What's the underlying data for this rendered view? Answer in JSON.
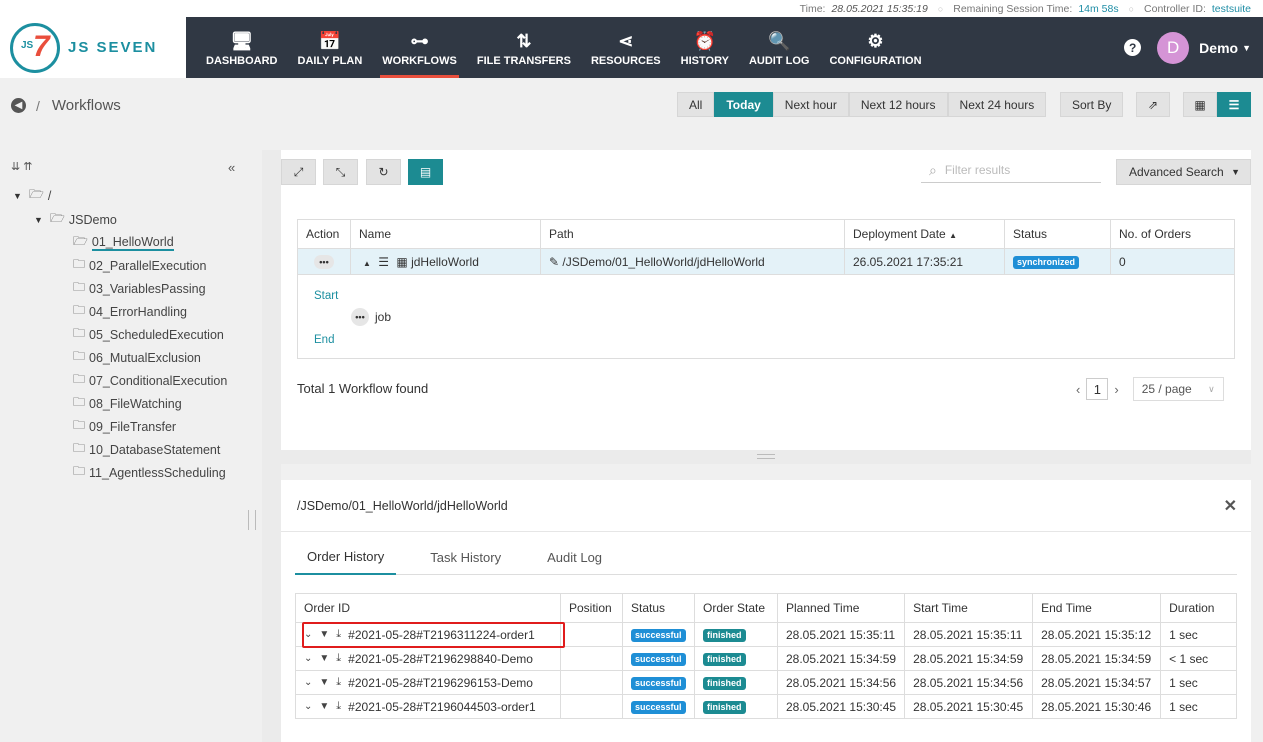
{
  "status_bar": {
    "time_label": "Time:",
    "time_value": "28.05.2021 15:35:19",
    "session_label": "Remaining Session Time:",
    "session_value": "14m 58s",
    "controller_label": "Controller ID:",
    "controller_value": "testsuite"
  },
  "logo": {
    "mark_small": "JS",
    "mark_big": "7",
    "text": "JS SEVEN"
  },
  "nav": [
    {
      "label": "DASHBOARD",
      "icon": "monitor-icon",
      "glyph": "🖥"
    },
    {
      "label": "DAILY PLAN",
      "icon": "calendar-icon",
      "glyph": "📅"
    },
    {
      "label": "WORKFLOWS",
      "icon": "workflow-icon",
      "glyph": "⊶"
    },
    {
      "label": "FILE TRANSFERS",
      "icon": "transfer-icon",
      "glyph": "⇅"
    },
    {
      "label": "RESOURCES",
      "icon": "share-icon",
      "glyph": "⋖"
    },
    {
      "label": "HISTORY",
      "icon": "clock-icon",
      "glyph": "⏰"
    },
    {
      "label": "AUDIT LOG",
      "icon": "audit-icon",
      "glyph": "🔍"
    },
    {
      "label": "CONFIGURATION",
      "icon": "gear-icon",
      "glyph": "⚙"
    }
  ],
  "user": {
    "initial": "D",
    "name": "Demo",
    "help": "?"
  },
  "breadcrumb": {
    "separator": "/",
    "title": "Workflows"
  },
  "filters": [
    "All",
    "Today",
    "Next hour",
    "Next 12 hours",
    "Next 24 hours"
  ],
  "sort_label": "Sort By",
  "tree": {
    "root": "/",
    "folder": "JSDemo",
    "items": [
      "01_HelloWorld",
      "02_ParallelExecution",
      "03_VariablesPassing",
      "04_ErrorHandling",
      "05_ScheduledExecution",
      "06_MutualExclusion",
      "07_ConditionalExecution",
      "08_FileWatching",
      "09_FileTransfer",
      "10_DatabaseStatement",
      "11_AgentlessScheduling"
    ]
  },
  "search": {
    "placeholder": "Filter results"
  },
  "advanced_search": "Advanced Search",
  "workflow_table": {
    "headers": [
      "Action",
      "Name",
      "Path",
      "Deployment Date",
      "Status",
      "No. of Orders"
    ],
    "rows": [
      {
        "name": "jdHelloWorld",
        "path": "/JSDemo/01_HelloWorld/jdHelloWorld",
        "deployment_date": "26.05.2021 17:35:21",
        "status": "synchronized",
        "orders": "0"
      }
    ],
    "detail": {
      "start": "Start",
      "job": "job",
      "end": "End"
    }
  },
  "total_text": "Total 1 Workflow found",
  "pagination": {
    "page": "1",
    "per_page": "25 / page"
  },
  "bottom_panel": {
    "path": "/JSDemo/01_HelloWorld/jdHelloWorld",
    "tabs": [
      "Order History",
      "Task History",
      "Audit Log"
    ],
    "headers": [
      "Order ID",
      "Position",
      "Status",
      "Order State",
      "Planned Time",
      "Start Time",
      "End Time",
      "Duration"
    ],
    "rows": [
      {
        "order_id": "#2021-05-28#T2196311224-order1",
        "position": "",
        "status": "successful",
        "state": "finished",
        "planned": "28.05.2021 15:35:11",
        "start": "28.05.2021 15:35:11",
        "end": "28.05.2021 15:35:12",
        "duration": "1 sec"
      },
      {
        "order_id": "#2021-05-28#T2196298840-Demo",
        "position": "",
        "status": "successful",
        "state": "finished",
        "planned": "28.05.2021 15:34:59",
        "start": "28.05.2021 15:34:59",
        "end": "28.05.2021 15:34:59",
        "duration": "< 1 sec"
      },
      {
        "order_id": "#2021-05-28#T2196296153-Demo",
        "position": "",
        "status": "successful",
        "state": "finished",
        "planned": "28.05.2021 15:34:56",
        "start": "28.05.2021 15:34:56",
        "end": "28.05.2021 15:34:57",
        "duration": "1 sec"
      },
      {
        "order_id": "#2021-05-28#T2196044503-order1",
        "position": "",
        "status": "successful",
        "state": "finished",
        "planned": "28.05.2021 15:30:45",
        "start": "28.05.2021 15:30:45",
        "end": "28.05.2021 15:30:46",
        "duration": "1 sec"
      }
    ]
  },
  "colors": {
    "accent": "#1c8b92",
    "header_bg": "#303844",
    "nav_active_underline": "#e94e3c",
    "badge_successful": "#1f8fd6",
    "badge_finished": "#1c8b92",
    "highlight_box": "#e01c1c"
  }
}
